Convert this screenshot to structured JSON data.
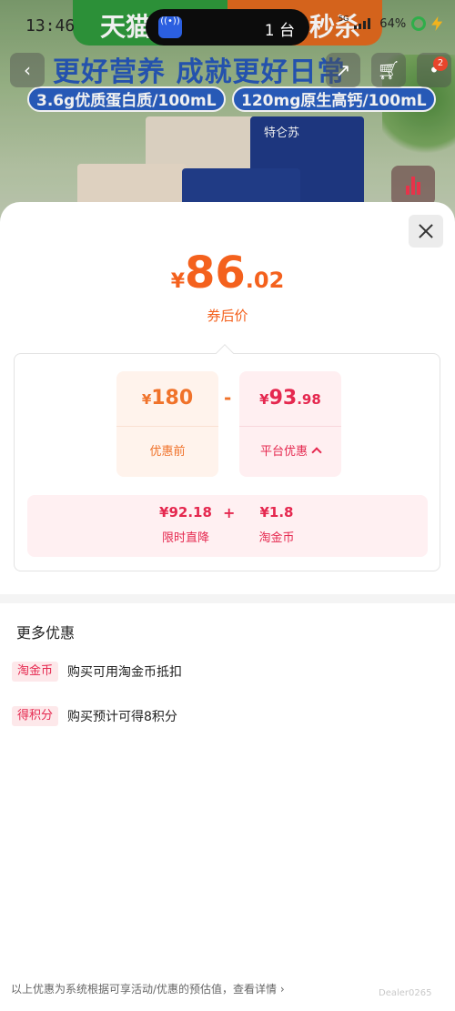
{
  "status_bar": {
    "time": "13:46",
    "island_text": "1 台",
    "network": "5G",
    "battery": "64%"
  },
  "background": {
    "banner_left": "天猫",
    "banner_right": "秒杀",
    "slogan": "更好营养 成就更好日常",
    "tag1": "3.6g优质蛋白质/100mL",
    "tag2": "120mg原生高钙/100mL",
    "brand": "特仑苏",
    "cart_badge": "2"
  },
  "price": {
    "currency": "¥",
    "integer": "86",
    "decimal": ".02",
    "label": "券后价"
  },
  "before": {
    "currency": "¥",
    "amount": "180",
    "label": "优惠前"
  },
  "minus": "-",
  "platform": {
    "currency": "¥",
    "integer": "93",
    "decimal": ".98",
    "label": "平台优惠"
  },
  "breakdown": {
    "item1_value": "¥92.18",
    "item1_label": "限时直降",
    "plus": "+",
    "item2_value": "¥1.8",
    "item2_label": "淘金币"
  },
  "more": {
    "title": "更多优惠",
    "perks": [
      {
        "tag": "淘金币",
        "desc": "购买可用淘金币抵扣"
      },
      {
        "tag": "得积分",
        "desc": "购买预计可得8积分"
      }
    ]
  },
  "footer": "以上优惠为系统根据可享活动/优惠的预估值，查看详情 ›",
  "watermark": "Dealer0265",
  "colors": {
    "accent_orange": "#f4611d",
    "accent_red": "#e5284f"
  }
}
